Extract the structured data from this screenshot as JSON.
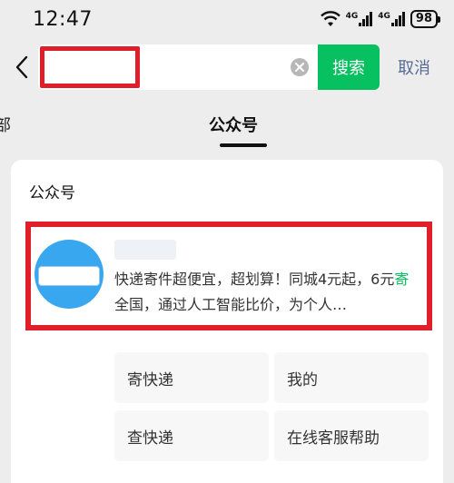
{
  "status_bar": {
    "time": "12:47",
    "net1": "4G",
    "net2": "4G",
    "battery": "98"
  },
  "search": {
    "query": "",
    "search_label": "搜索",
    "cancel_label": "取消"
  },
  "tabs": {
    "partial_label": "部",
    "active_label": "公众号"
  },
  "results": {
    "section_title": "公众号",
    "account": {
      "name": "",
      "desc_part1": "快递寄件超便宜，超划算！同城4元起，6元",
      "desc_highlight": "寄",
      "desc_part2": "全国，通过人工智能比价，为个人…"
    },
    "menu": [
      {
        "label": "寄快递"
      },
      {
        "label": "我的"
      },
      {
        "label": "查快递"
      },
      {
        "label": "在线客服帮助"
      }
    ]
  },
  "colors": {
    "accent_green": "#07c160",
    "link_blue": "#576b95",
    "annotation_red": "#e01e2a",
    "avatar_blue": "#39a7ef"
  }
}
